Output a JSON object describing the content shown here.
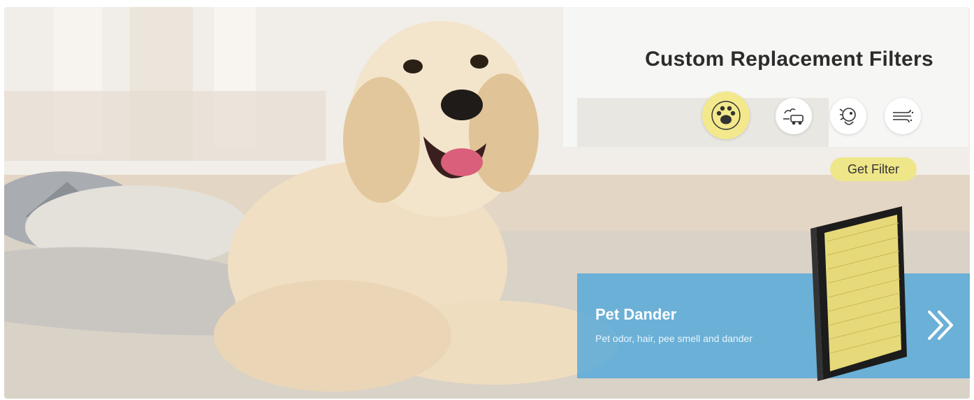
{
  "banner": {
    "title": "Custom Replacement Filters",
    "icons": [
      {
        "name": "paw-icon",
        "active": true
      },
      {
        "name": "smoke-car-icon",
        "active": false
      },
      {
        "name": "allergy-icon",
        "active": false
      },
      {
        "name": "wind-icon",
        "active": false
      }
    ],
    "cta_label": "Get Filter",
    "info_title": "Pet Dander",
    "info_desc": "Pet odor, hair, pee smell and dander",
    "next_icon": "double-chevron-right-icon"
  },
  "colors": {
    "accent_yellow": "#efe68a",
    "info_blue": "#4fa7db",
    "title_text": "#2c2c2c"
  }
}
